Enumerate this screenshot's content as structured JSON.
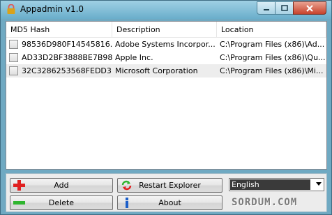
{
  "window": {
    "title": "Appadmin v1.0",
    "icon": "lock-icon",
    "controls": [
      "minimize-icon",
      "maximize-icon",
      "close-icon"
    ]
  },
  "list": {
    "columns": [
      "MD5 Hash",
      "Description",
      "Location"
    ],
    "rows": [
      {
        "hash": "98536D980F14545816...",
        "description": "Adobe Systems Incorpor...",
        "location": "C:\\Program Files (x86)\\Ad...",
        "checked": false,
        "selected": false
      },
      {
        "hash": "AD33D2BF3888BE7B98...",
        "description": "Apple Inc.",
        "location": "C:\\Program Files (x86)\\Qu...",
        "checked": false,
        "selected": false
      },
      {
        "hash": "32C3286253568FEDD3...",
        "description": "Microsoft Corporation",
        "location": "C:\\Program Files (x86)\\Mi...",
        "checked": false,
        "selected": true
      }
    ]
  },
  "buttons": {
    "add": "Add",
    "delete": "Delete",
    "restart": "Restart Explorer",
    "about": "About"
  },
  "language": {
    "selected": "English"
  },
  "logo": {
    "text": "SORDUM.COM"
  },
  "colors": {
    "titlebar": "#6aaecb",
    "close_button": "#c7432b",
    "add_icon": "#e02020",
    "delete_icon": "#2fb52f",
    "about_icon": "#1c5fc9"
  }
}
